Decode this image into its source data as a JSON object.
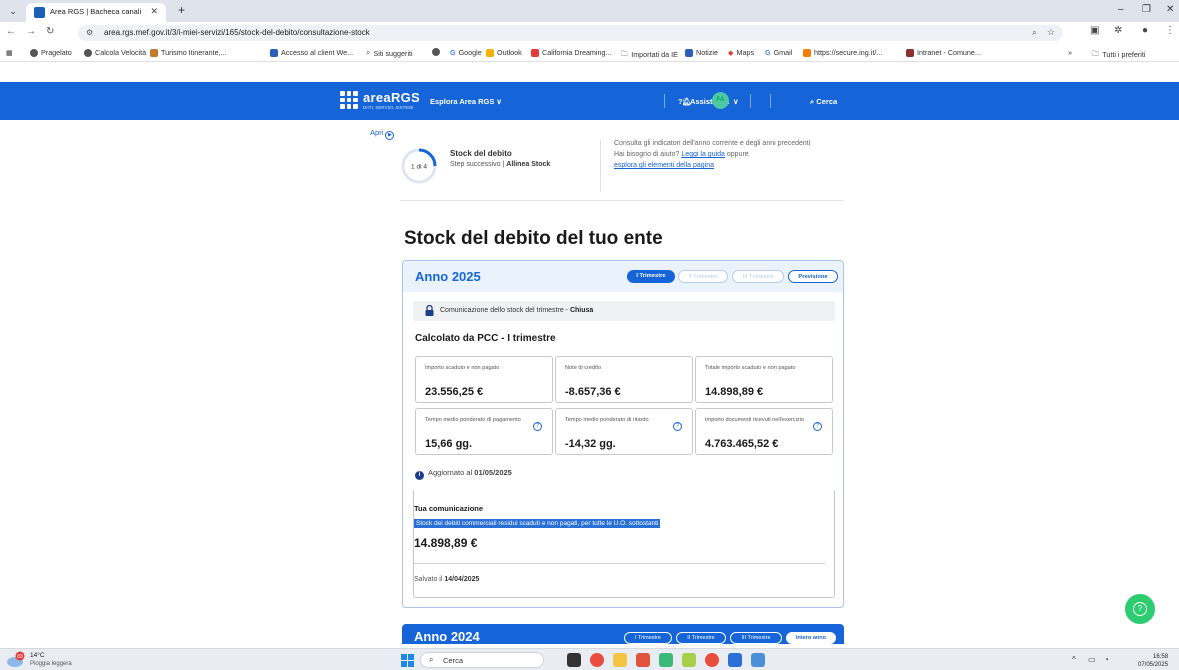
{
  "browser": {
    "tab_title": "Area RGS | Bacheca canali",
    "url": "area.rgs.mef.gov.it/3/i-miei-servizi/165/stock-del-debito/consultazione-stock",
    "bookmarks": [
      "Pragelato",
      "Calcola Velocità",
      "Turismo Itinerante,...",
      "Accesso al client We...",
      "Siti suggeriti",
      "Google",
      "Outlook",
      "California Dreaming...",
      "Importati da IE",
      "Notizie",
      "Maps",
      "Gmail",
      "https://secure.ing.it/...",
      "Intranet - Comune..."
    ],
    "bookmarks_more": "»",
    "all_bookmarks": "Tutti i preferiti"
  },
  "header": {
    "logo": "areaRGS",
    "logo_sub": "DATI, SERVIZI, SISTEMI",
    "explore": "Esplora Area RGS ∨",
    "assist": "Assistenza",
    "avatar": "FA",
    "avatar_chevron": "∨",
    "search": "Cerca"
  },
  "onboarding": {
    "open": "Apri",
    "step": "1 di 4",
    "title": "Stock del debito",
    "next_prefix": "Step successivo |",
    "next": "Allinea Stock",
    "help_line1": "Consulta gli indicatori dell'anno corrente e degli anni precedenti",
    "help_line2": "Hai bisogno di aiuto?",
    "help_link1": "Leggi la guida",
    "help_or": "oppure",
    "help_link2": "esplora gli elementi della pagina"
  },
  "page_title": "Stock del debito del tuo ente",
  "card2025": {
    "year": "Anno 2025",
    "pills": [
      "I Trimestre",
      "II Trimestre",
      "III Trimestre",
      "Previsione"
    ],
    "notice_text": "Comunicazione dello stock del trimestre - ",
    "notice_status": "Chiusa",
    "section_title": "Calcolato da PCC - I trimestre",
    "metrics": [
      {
        "label": "Importo scaduto e non pagato",
        "value": "23.556,25 €"
      },
      {
        "label": "Note di credito",
        "value": "-8.657,36 €"
      },
      {
        "label": "Totale importo scaduto e non pagato",
        "value": "14.898,89 €"
      },
      {
        "label": "Tempo medio ponderato di pagamento",
        "value": "15,66 gg."
      },
      {
        "label": "Tempo medio ponderato di ritardo",
        "value": "-14,32 gg."
      },
      {
        "label": "Importo documenti ricevuti nell'esercizio",
        "value": "4.763.465,52 €"
      }
    ],
    "updated_prefix": "Aggiornato al",
    "updated_date": "01/05/2025",
    "comm_title": "Tua comunicazione",
    "comm_desc": "Stock dei debiti commerciali residui scaduti e non pagati, per tutte le U.O. sottostanti",
    "comm_value": "14.898,89 €",
    "saved_prefix": "Salvato il",
    "saved_date": "14/04/2025"
  },
  "card2024": {
    "year": "Anno 2024",
    "pills": [
      "I Trimestre",
      "II Trimestre",
      "III Trimestre",
      "Intero anno"
    ]
  },
  "taskbar": {
    "temp": "14°C",
    "weather": "Pioggia leggera",
    "weather_badge": "83",
    "search": "Cerca",
    "time": "16:58",
    "date": "07/05/2025"
  }
}
